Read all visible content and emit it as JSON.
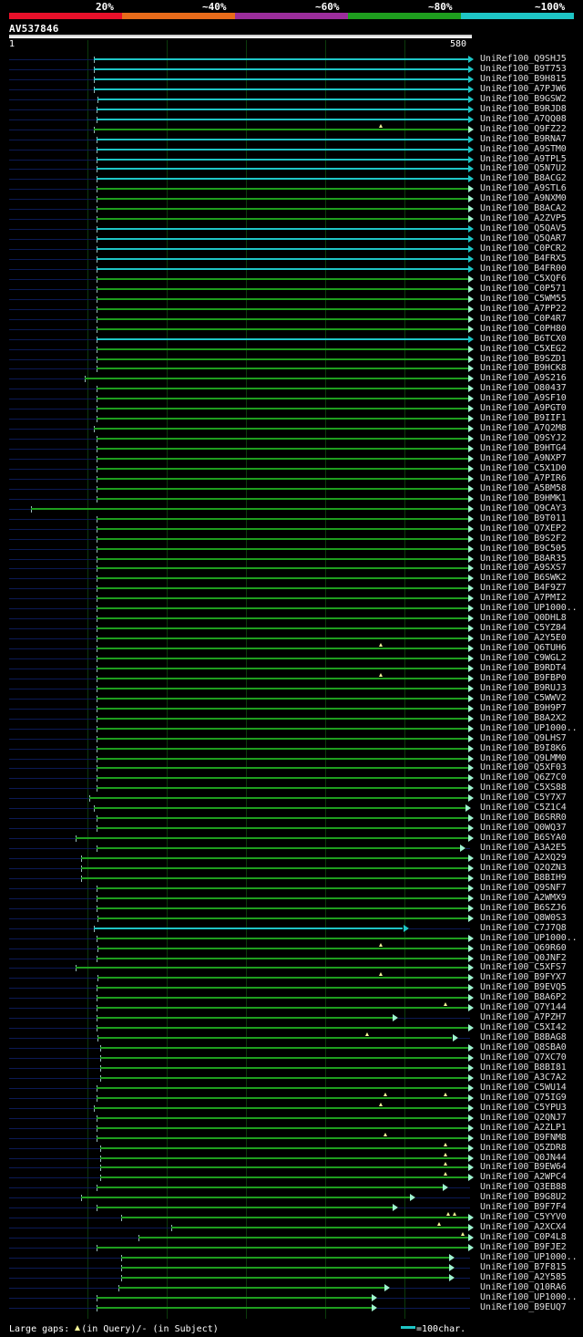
{
  "legend": {
    "segments": [
      {
        "label": "20%",
        "color": "#e8102a"
      },
      {
        "label": "~40%",
        "color": "#e86b1a"
      },
      {
        "label": "~60%",
        "color": "#9b2d9b"
      },
      {
        "label": "~80%",
        "color": "#1e9e1e"
      },
      {
        "label": "~100%",
        "color": "#1ec5c5"
      }
    ]
  },
  "query": {
    "id": "AV537846",
    "start": "1",
    "end": "580",
    "length": 580
  },
  "scale_units": {
    "query_start": 1,
    "query_end": 580
  },
  "hits": [
    {
      "id": "UniRef100_Q9SHJ5",
      "color": "#1ec5c5",
      "start": 108,
      "end": 580,
      "gaps": []
    },
    {
      "id": "UniRef100_B9T753",
      "color": "#1ec5c5",
      "start": 108,
      "end": 580,
      "gaps": []
    },
    {
      "id": "UniRef100_B9H815",
      "color": "#1ec5c5",
      "start": 108,
      "end": 580,
      "gaps": []
    },
    {
      "id": "UniRef100_A7PJW6",
      "color": "#1ec5c5",
      "start": 108,
      "end": 580,
      "gaps": []
    },
    {
      "id": "UniRef100_B9GSW2",
      "color": "#1ec5c5",
      "start": 113,
      "end": 580,
      "gaps": []
    },
    {
      "id": "UniRef100_B9RJD8",
      "color": "#1ec5c5",
      "start": 111,
      "end": 580,
      "gaps": []
    },
    {
      "id": "UniRef100_A7QQ08",
      "color": "#1ec5c5",
      "start": 111,
      "end": 580,
      "gaps": []
    },
    {
      "id": "UniRef100_Q9FZ22",
      "color": "#1e9e1e",
      "start": 108,
      "end": 580,
      "gaps": [
        470
      ]
    },
    {
      "id": "UniRef100_B9RNA7",
      "color": "#1ec5c5",
      "start": 111,
      "end": 580,
      "gaps": []
    },
    {
      "id": "UniRef100_A9STM0",
      "color": "#1ec5c5",
      "start": 111,
      "end": 580,
      "gaps": []
    },
    {
      "id": "UniRef100_A9TPL5",
      "color": "#1ec5c5",
      "start": 111,
      "end": 580,
      "gaps": []
    },
    {
      "id": "UniRef100_Q5N7U2",
      "color": "#1ec5c5",
      "start": 111,
      "end": 580,
      "gaps": []
    },
    {
      "id": "UniRef100_B8ACG2",
      "color": "#1ec5c5",
      "start": 111,
      "end": 580,
      "gaps": []
    },
    {
      "id": "UniRef100_A9STL6",
      "color": "#1e9e1e",
      "start": 111,
      "end": 580,
      "gaps": []
    },
    {
      "id": "UniRef100_A9NXM0",
      "color": "#1e9e1e",
      "start": 111,
      "end": 580,
      "gaps": []
    },
    {
      "id": "UniRef100_B8ACA2",
      "color": "#1e9e1e",
      "start": 111,
      "end": 580,
      "gaps": []
    },
    {
      "id": "UniRef100_A2ZVP5",
      "color": "#1e9e1e",
      "start": 111,
      "end": 580,
      "gaps": []
    },
    {
      "id": "UniRef100_Q5QAV5",
      "color": "#1ec5c5",
      "start": 111,
      "end": 580,
      "gaps": []
    },
    {
      "id": "UniRef100_Q5QAR7",
      "color": "#1ec5c5",
      "start": 111,
      "end": 580,
      "gaps": []
    },
    {
      "id": "UniRef100_C0PCR2",
      "color": "#1ec5c5",
      "start": 111,
      "end": 580,
      "gaps": []
    },
    {
      "id": "UniRef100_B4FRX5",
      "color": "#1ec5c5",
      "start": 111,
      "end": 580,
      "gaps": []
    },
    {
      "id": "UniRef100_B4FR00",
      "color": "#1ec5c5",
      "start": 111,
      "end": 580,
      "gaps": []
    },
    {
      "id": "UniRef100_C5XQF6",
      "color": "#1e9e1e",
      "start": 111,
      "end": 580,
      "gaps": []
    },
    {
      "id": "UniRef100_C0P571",
      "color": "#1e9e1e",
      "start": 111,
      "end": 580,
      "gaps": []
    },
    {
      "id": "UniRef100_C5WM55",
      "color": "#1e9e1e",
      "start": 111,
      "end": 580,
      "gaps": []
    },
    {
      "id": "UniRef100_A7PP22",
      "color": "#1e9e1e",
      "start": 111,
      "end": 580,
      "gaps": []
    },
    {
      "id": "UniRef100_C0P4R7",
      "color": "#1e9e1e",
      "start": 111,
      "end": 580,
      "gaps": []
    },
    {
      "id": "UniRef100_C0PH80",
      "color": "#1e9e1e",
      "start": 111,
      "end": 580,
      "gaps": []
    },
    {
      "id": "UniRef100_B6TCX0",
      "color": "#1ec5c5",
      "start": 111,
      "end": 580,
      "gaps": []
    },
    {
      "id": "UniRef100_C5XEG2",
      "color": "#1e9e1e",
      "start": 111,
      "end": 580,
      "gaps": []
    },
    {
      "id": "UniRef100_B9SZD1",
      "color": "#1e9e1e",
      "start": 111,
      "end": 580,
      "gaps": []
    },
    {
      "id": "UniRef100_B9HCK8",
      "color": "#1e9e1e",
      "start": 111,
      "end": 580,
      "gaps": []
    },
    {
      "id": "UniRef100_A9S216",
      "color": "#1e9e1e",
      "start": 96,
      "end": 580,
      "gaps": []
    },
    {
      "id": "UniRef100_O80437",
      "color": "#1e9e1e",
      "start": 111,
      "end": 580,
      "gaps": []
    },
    {
      "id": "UniRef100_A9SF10",
      "color": "#1e9e1e",
      "start": 111,
      "end": 580,
      "gaps": []
    },
    {
      "id": "UniRef100_A9PGT0",
      "color": "#1e9e1e",
      "start": 111,
      "end": 580,
      "gaps": []
    },
    {
      "id": "UniRef100_B9IIF1",
      "color": "#1e9e1e",
      "start": 111,
      "end": 580,
      "gaps": []
    },
    {
      "id": "UniRef100_A7Q2M8",
      "color": "#1e9e1e",
      "start": 108,
      "end": 580,
      "gaps": []
    },
    {
      "id": "UniRef100_Q9SYJ2",
      "color": "#1e9e1e",
      "start": 111,
      "end": 580,
      "gaps": []
    },
    {
      "id": "UniRef100_B9HTG4",
      "color": "#1e9e1e",
      "start": 111,
      "end": 580,
      "gaps": []
    },
    {
      "id": "UniRef100_A9NXP7",
      "color": "#1e9e1e",
      "start": 111,
      "end": 580,
      "gaps": []
    },
    {
      "id": "UniRef100_C5X1D0",
      "color": "#1e9e1e",
      "start": 111,
      "end": 580,
      "gaps": []
    },
    {
      "id": "UniRef100_A7PIR6",
      "color": "#1e9e1e",
      "start": 111,
      "end": 580,
      "gaps": []
    },
    {
      "id": "UniRef100_A5BM58",
      "color": "#1e9e1e",
      "start": 111,
      "end": 580,
      "gaps": []
    },
    {
      "id": "UniRef100_B9HMK1",
      "color": "#1e9e1e",
      "start": 111,
      "end": 580,
      "gaps": []
    },
    {
      "id": "UniRef100_Q9CAY3",
      "color": "#1e9e1e",
      "start": 29,
      "end": 580,
      "gaps": []
    },
    {
      "id": "UniRef100_B9T011",
      "color": "#1e9e1e",
      "start": 111,
      "end": 580,
      "gaps": []
    },
    {
      "id": "UniRef100_Q7XEP2",
      "color": "#1e9e1e",
      "start": 111,
      "end": 580,
      "gaps": []
    },
    {
      "id": "UniRef100_B9S2F2",
      "color": "#1e9e1e",
      "start": 111,
      "end": 580,
      "gaps": []
    },
    {
      "id": "UniRef100_B9C505",
      "color": "#1e9e1e",
      "start": 111,
      "end": 580,
      "gaps": []
    },
    {
      "id": "UniRef100_B8AR35",
      "color": "#1e9e1e",
      "start": 111,
      "end": 580,
      "gaps": []
    },
    {
      "id": "UniRef100_A9SXS7",
      "color": "#1e9e1e",
      "start": 111,
      "end": 580,
      "gaps": []
    },
    {
      "id": "UniRef100_B6SWK2",
      "color": "#1e9e1e",
      "start": 111,
      "end": 580,
      "gaps": []
    },
    {
      "id": "UniRef100_B4F9Z7",
      "color": "#1e9e1e",
      "start": 111,
      "end": 580,
      "gaps": []
    },
    {
      "id": "UniRef100_A7PMI2",
      "color": "#1e9e1e",
      "start": 111,
      "end": 580,
      "gaps": []
    },
    {
      "id": "UniRef100_UP1000..",
      "color": "#1e9e1e",
      "start": 111,
      "end": 580,
      "gaps": []
    },
    {
      "id": "UniRef100_Q0DHL8",
      "color": "#1e9e1e",
      "start": 111,
      "end": 580,
      "gaps": []
    },
    {
      "id": "UniRef100_C5YZ84",
      "color": "#1e9e1e",
      "start": 111,
      "end": 580,
      "gaps": []
    },
    {
      "id": "UniRef100_A2Y5E0",
      "color": "#1e9e1e",
      "start": 111,
      "end": 580,
      "gaps": []
    },
    {
      "id": "UniRef100_Q6TUH6",
      "color": "#1e9e1e",
      "start": 111,
      "end": 580,
      "gaps": [
        470
      ]
    },
    {
      "id": "UniRef100_C9WGL2",
      "color": "#1e9e1e",
      "start": 111,
      "end": 580,
      "gaps": []
    },
    {
      "id": "UniRef100_B9RDT4",
      "color": "#1e9e1e",
      "start": 111,
      "end": 580,
      "gaps": []
    },
    {
      "id": "UniRef100_B9FBP0",
      "color": "#1e9e1e",
      "start": 111,
      "end": 580,
      "gaps": [
        470
      ]
    },
    {
      "id": "UniRef100_B9RUJ3",
      "color": "#1e9e1e",
      "start": 111,
      "end": 580,
      "gaps": []
    },
    {
      "id": "UniRef100_C5WWV2",
      "color": "#1e9e1e",
      "start": 111,
      "end": 580,
      "gaps": []
    },
    {
      "id": "UniRef100_B9H9P7",
      "color": "#1e9e1e",
      "start": 111,
      "end": 580,
      "gaps": []
    },
    {
      "id": "UniRef100_B8A2X2",
      "color": "#1e9e1e",
      "start": 111,
      "end": 580,
      "gaps": []
    },
    {
      "id": "UniRef100_UP1000..",
      "color": "#1e9e1e",
      "start": 111,
      "end": 580,
      "gaps": []
    },
    {
      "id": "UniRef100_Q9LHS7",
      "color": "#1e9e1e",
      "start": 111,
      "end": 580,
      "gaps": []
    },
    {
      "id": "UniRef100_B9I8K6",
      "color": "#1e9e1e",
      "start": 111,
      "end": 580,
      "gaps": []
    },
    {
      "id": "UniRef100_Q9LMM0",
      "color": "#1e9e1e",
      "start": 111,
      "end": 580,
      "gaps": []
    },
    {
      "id": "UniRef100_Q5XF03",
      "color": "#1e9e1e",
      "start": 111,
      "end": 580,
      "gaps": []
    },
    {
      "id": "UniRef100_Q6Z7C0",
      "color": "#1e9e1e",
      "start": 111,
      "end": 580,
      "gaps": []
    },
    {
      "id": "UniRef100_C5XS88",
      "color": "#1e9e1e",
      "start": 111,
      "end": 580,
      "gaps": []
    },
    {
      "id": "UniRef100_C5Y7X7",
      "color": "#1e9e1e",
      "start": 102,
      "end": 580,
      "gaps": []
    },
    {
      "id": "UniRef100_C5Z1C4",
      "color": "#1e9e1e",
      "start": 108,
      "end": 577,
      "gaps": []
    },
    {
      "id": "UniRef100_B6SRR0",
      "color": "#1e9e1e",
      "start": 111,
      "end": 580,
      "gaps": []
    },
    {
      "id": "UniRef100_Q0WQ37",
      "color": "#1e9e1e",
      "start": 111,
      "end": 580,
      "gaps": []
    },
    {
      "id": "UniRef100_B6SYA0",
      "color": "#1e9e1e",
      "start": 85,
      "end": 580,
      "gaps": []
    },
    {
      "id": "UniRef100_A3A2E5",
      "color": "#1e9e1e",
      "start": 111,
      "end": 570,
      "gaps": []
    },
    {
      "id": "UniRef100_A2XQ29",
      "color": "#1e9e1e",
      "start": 92,
      "end": 580,
      "gaps": []
    },
    {
      "id": "UniRef100_Q2QZN3",
      "color": "#1e9e1e",
      "start": 92,
      "end": 580,
      "gaps": []
    },
    {
      "id": "UniRef100_B8BIH9",
      "color": "#1e9e1e",
      "start": 92,
      "end": 580,
      "gaps": []
    },
    {
      "id": "UniRef100_Q9SNF7",
      "color": "#1e9e1e",
      "start": 111,
      "end": 580,
      "gaps": []
    },
    {
      "id": "UniRef100_A2WMX9",
      "color": "#1e9e1e",
      "start": 111,
      "end": 580,
      "gaps": []
    },
    {
      "id": "UniRef100_B6SZJ6",
      "color": "#1e9e1e",
      "start": 111,
      "end": 580,
      "gaps": []
    },
    {
      "id": "UniRef100_Q8W0S3",
      "color": "#1e9e1e",
      "start": 113,
      "end": 580,
      "gaps": []
    },
    {
      "id": "UniRef100_C7J7Q8",
      "color": "#1ec5c5",
      "start": 108,
      "end": 498,
      "gaps": []
    },
    {
      "id": "UniRef100_UP1000..",
      "color": "#1e9e1e",
      "start": 111,
      "end": 580,
      "gaps": []
    },
    {
      "id": "UniRef100_Q69R60",
      "color": "#1e9e1e",
      "start": 113,
      "end": 580,
      "gaps": [
        470
      ]
    },
    {
      "id": "UniRef100_Q0JNF2",
      "color": "#1e9e1e",
      "start": 111,
      "end": 580,
      "gaps": []
    },
    {
      "id": "UniRef100_C5XFS7",
      "color": "#1e9e1e",
      "start": 85,
      "end": 580,
      "gaps": []
    },
    {
      "id": "UniRef100_B9FYX7",
      "color": "#1e9e1e",
      "start": 113,
      "end": 580,
      "gaps": [
        470
      ]
    },
    {
      "id": "UniRef100_B9EVQ5",
      "color": "#1e9e1e",
      "start": 111,
      "end": 580,
      "gaps": []
    },
    {
      "id": "UniRef100_B8A6P2",
      "color": "#1e9e1e",
      "start": 111,
      "end": 580,
      "gaps": []
    },
    {
      "id": "UniRef100_Q7Y144",
      "color": "#1e9e1e",
      "start": 111,
      "end": 580,
      "gaps": [
        551
      ]
    },
    {
      "id": "UniRef100_A7PZH7",
      "color": "#1e9e1e",
      "start": 111,
      "end": 485,
      "gaps": []
    },
    {
      "id": "UniRef100_C5XI42",
      "color": "#1e9e1e",
      "start": 111,
      "end": 580,
      "gaps": []
    },
    {
      "id": "UniRef100_B8BAG8",
      "color": "#1e9e1e",
      "start": 113,
      "end": 560,
      "gaps": [
        453
      ]
    },
    {
      "id": "UniRef100_Q8SBA0",
      "color": "#1e9e1e",
      "start": 116,
      "end": 580,
      "gaps": []
    },
    {
      "id": "UniRef100_Q7XC70",
      "color": "#1e9e1e",
      "start": 116,
      "end": 580,
      "gaps": []
    },
    {
      "id": "UniRef100_B8BI81",
      "color": "#1e9e1e",
      "start": 116,
      "end": 580,
      "gaps": []
    },
    {
      "id": "UniRef100_A3C7A2",
      "color": "#1e9e1e",
      "start": 116,
      "end": 580,
      "gaps": []
    },
    {
      "id": "UniRef100_C5WU14",
      "color": "#1e9e1e",
      "start": 111,
      "end": 580,
      "gaps": []
    },
    {
      "id": "UniRef100_Q75IG9",
      "color": "#1e9e1e",
      "start": 111,
      "end": 580,
      "gaps": [
        551,
        476
      ]
    },
    {
      "id": "UniRef100_C5YPU3",
      "color": "#1e9e1e",
      "start": 108,
      "end": 580,
      "gaps": [
        470
      ]
    },
    {
      "id": "UniRef100_Q2QNJ7",
      "color": "#1e9e1e",
      "start": 111,
      "end": 580,
      "gaps": []
    },
    {
      "id": "UniRef100_A2ZLP1",
      "color": "#1e9e1e",
      "start": 111,
      "end": 580,
      "gaps": []
    },
    {
      "id": "UniRef100_B9FNM8",
      "color": "#1e9e1e",
      "start": 111,
      "end": 580,
      "gaps": [
        476
      ]
    },
    {
      "id": "UniRef100_Q5ZDR8",
      "color": "#1e9e1e",
      "start": 116,
      "end": 580,
      "gaps": [
        551
      ]
    },
    {
      "id": "UniRef100_Q0JN44",
      "color": "#1e9e1e",
      "start": 116,
      "end": 580,
      "gaps": [
        551
      ]
    },
    {
      "id": "UniRef100_B9EW64",
      "color": "#1e9e1e",
      "start": 116,
      "end": 580,
      "gaps": [
        551
      ]
    },
    {
      "id": "UniRef100_A2WPC4",
      "color": "#1e9e1e",
      "start": 116,
      "end": 580,
      "gaps": [
        551
      ]
    },
    {
      "id": "UniRef100_Q3EB88",
      "color": "#1e9e1e",
      "start": 111,
      "end": 548,
      "gaps": []
    },
    {
      "id": "UniRef100_B9G8U2",
      "color": "#1e9e1e",
      "start": 92,
      "end": 507,
      "gaps": []
    },
    {
      "id": "UniRef100_B9F7F4",
      "color": "#1e9e1e",
      "start": 111,
      "end": 485,
      "gaps": []
    },
    {
      "id": "UniRef100_C5YYV0",
      "color": "#1e9e1e",
      "start": 142,
      "end": 580,
      "gaps": [
        555,
        563
      ]
    },
    {
      "id": "UniRef100_A2XCX4",
      "color": "#1e9e1e",
      "start": 206,
      "end": 580,
      "gaps": [
        543
      ]
    },
    {
      "id": "UniRef100_C0P4L8",
      "color": "#1e9e1e",
      "start": 164,
      "end": 580,
      "gaps": [
        573
      ]
    },
    {
      "id": "UniRef100_B9FJE2",
      "color": "#1e9e1e",
      "start": 111,
      "end": 580,
      "gaps": []
    },
    {
      "id": "UniRef100_UP1000..",
      "color": "#1e9e1e",
      "start": 142,
      "end": 556,
      "gaps": []
    },
    {
      "id": "UniRef100_B7F815",
      "color": "#1e9e1e",
      "start": 142,
      "end": 556,
      "gaps": []
    },
    {
      "id": "UniRef100_A2Y585",
      "color": "#1e9e1e",
      "start": 142,
      "end": 556,
      "gaps": []
    },
    {
      "id": "UniRef100_Q10RA6",
      "color": "#1e9e1e",
      "start": 139,
      "end": 474,
      "gaps": []
    },
    {
      "id": "UniRef100_UP1000..",
      "color": "#1e9e1e",
      "start": 111,
      "end": 458,
      "gaps": []
    },
    {
      "id": "UniRef100_B9EUQ7",
      "color": "#1e9e1e",
      "start": 111,
      "end": 458,
      "gaps": []
    }
  ],
  "footer": {
    "text_prefix": "Large gaps: ",
    "in_query": "(in Query)/- (in Subject)",
    "scale_label": "=100char."
  }
}
